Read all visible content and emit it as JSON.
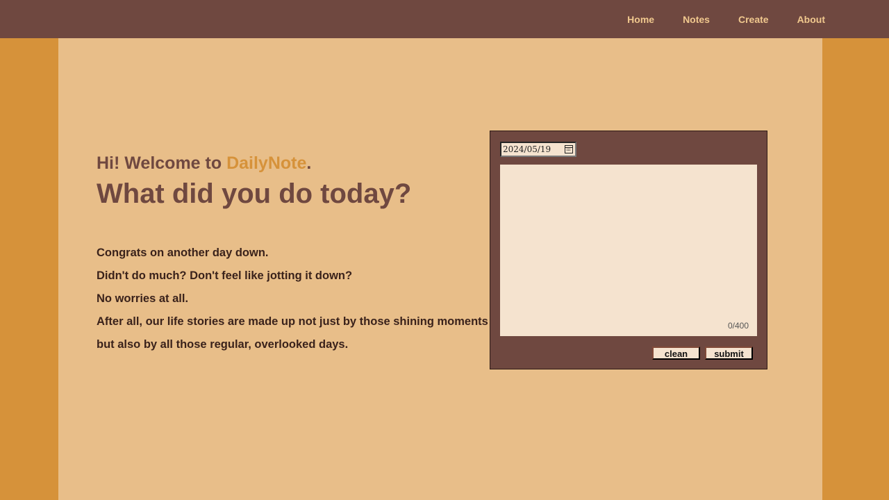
{
  "nav": {
    "items": [
      {
        "label": "Home"
      },
      {
        "label": "Notes"
      },
      {
        "label": "Create"
      },
      {
        "label": "About"
      }
    ]
  },
  "hero": {
    "greeting_prefix": "Hi! Welcome to ",
    "brand": "DailyNote",
    "greeting_suffix": ".",
    "headline": "What did you do today?",
    "paragraphs": [
      "Congrats on another day down.",
      "Didn't do much? Don't feel like jotting it down?",
      "No worries at all.",
      "After all, our life stories are made up not just by those shining moments",
      "but also by all those regular, overlooked days."
    ]
  },
  "editor": {
    "date_value": "2024/05/19",
    "note_text": "",
    "char_counter": "0/400",
    "clean_label": "clean",
    "submit_label": "submit"
  },
  "colors": {
    "topbar": "#6f4840",
    "nav_text": "#f0c88e",
    "side_background": "#d6923a",
    "main_background": "#e8be89",
    "brand_accent": "#d6923a",
    "panel": "#6f4840",
    "textarea": "#f5e3cf"
  }
}
